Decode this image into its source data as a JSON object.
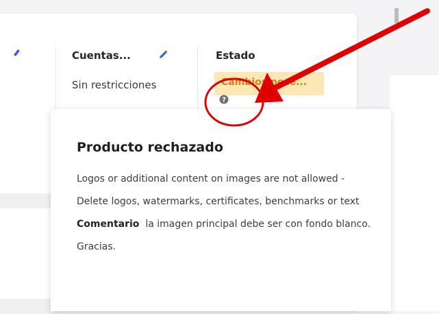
{
  "columns": {
    "accounts": {
      "title": "Cuentas...",
      "value": "Sin restricciones"
    },
    "status": {
      "title": "Estado",
      "badge": "Cambios nece..."
    }
  },
  "tooltip": {
    "title": "Producto rechazado",
    "message": "Logos or additional content on images are not allowed - Delete logos, watermarks, certificates, benchmarks or text",
    "comment_label": "Comentario",
    "comment_text": "la imagen principal debe ser con fondo blanco. Gracias."
  },
  "colors": {
    "accent": "#3d5ae0",
    "badge_bg": "#fde7b4",
    "badge_text": "#d0801a",
    "annotation": "#e00000"
  },
  "icons": [
    "pencil-icon",
    "help-icon"
  ]
}
